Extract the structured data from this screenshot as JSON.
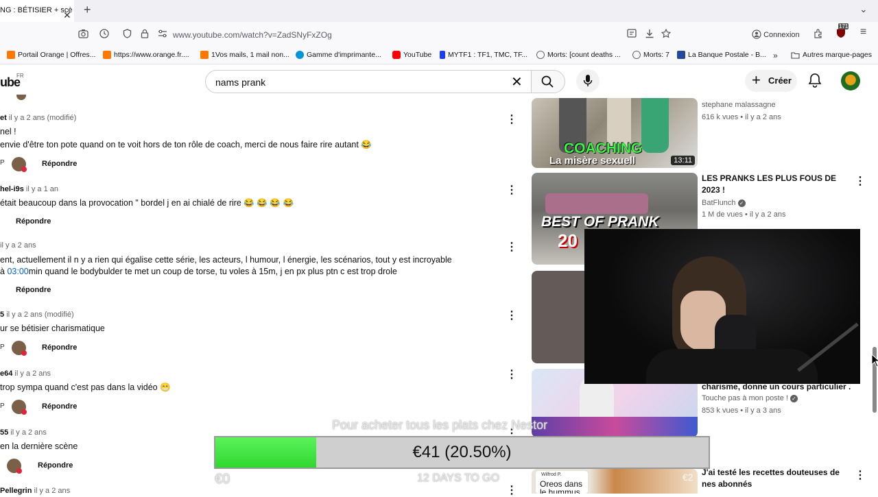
{
  "browser": {
    "tab_title": "NG : BÉTISIER + scè",
    "url": "www.youtube.com/watch?v=ZadSNyFxZOg",
    "login_label": "Connexion",
    "extension_badge": "171",
    "bookmarks": [
      {
        "label": "Portail Orange | Offres...",
        "color": "#ff7900"
      },
      {
        "label": "https://www.orange.fr....",
        "color": "#ff7900"
      },
      {
        "label": "1Vos mails, 1 mail non...",
        "color": "#ff7900"
      },
      {
        "label": "Gamme d'imprimante...",
        "color": "#0096d6"
      },
      {
        "label": "YouTube",
        "color": "#ff0000"
      },
      {
        "label": "MYTF1 : TF1, TMC, TF...",
        "color": "#1a3cff"
      },
      {
        "label": "Morts: [count deaths ...",
        "color": "#666666"
      },
      {
        "label": "Morts: 7",
        "color": "#666666"
      },
      {
        "label": "La Banque Postale - B...",
        "color": "#254a9b"
      }
    ],
    "bookmarks_other": "Autres marque-pages"
  },
  "youtube": {
    "logo": "ube",
    "country": "FR",
    "search_value": "nams prank",
    "create_label": "Créer"
  },
  "comments": [
    {
      "name": "et",
      "time": "il y a 2 ans (modifié)",
      "lines": [
        "nel !",
        "envie d'être ton pote quand on te voit hors de ton rôle de coach, merci de nous faire rire autant 😂"
      ],
      "reply": "Répondre"
    },
    {
      "name": "hel-i9s",
      "time": "il y a 1 an",
      "lines": [
        "était beaucoup dans la provocation \" bordel j en ai chialé de rire 😂 😂 😂 😂"
      ],
      "reply": "Répondre"
    },
    {
      "name": "",
      "time": "il y a 2 ans",
      "lines": [
        "ent, actuellement il n y a rien qui égalise cette série, les acteurs, l humour, l énergie, les scénarios, tout y est incroyable"
      ],
      "line2_prefix": " à ",
      "line2_timestamp": "03:00",
      "line2_suffix": "min quand le bodybulder te met un coup de torse, tu voles à 15m, j en px plus ptn c est trop drole",
      "reply": "Répondre"
    },
    {
      "name": "5",
      "time": "il y a 2 ans (modifié)",
      "lines": [
        "ur se bétisier charismatique"
      ],
      "reply": "Répondre"
    },
    {
      "name": "e64",
      "time": "il y a 2 ans",
      "lines": [
        "trop sympa quand c'est pas dans la vidéo 😁"
      ],
      "reply": "Répondre"
    },
    {
      "name": "55",
      "time": "il y a 2 ans",
      "lines": [
        "en la dernière scène"
      ],
      "reply": "Répondre"
    },
    {
      "name": "Pellegrin",
      "time": "il y a 2 ans"
    }
  ],
  "sidebar": [
    {
      "channel": "stephane malassagne",
      "meta": "616 k vues • il y a 2 ans",
      "thumb_text_1": "COACHING",
      "thumb_text_2": "La misère sexuell",
      "duration": "13:11"
    },
    {
      "title": "LES PRANKS LES PLUS FOUS DE 2023 !",
      "channel": "BatFlunch",
      "meta": "1 M de vues • il y a 2 ans",
      "thumb_text": "BEST OF PRANK",
      "thumb_text_2": "20"
    },
    {},
    {
      "title": "charisme, donne un cours particulier ...",
      "channel": "Touche pas à mon poste !",
      "meta": "853 k vues • il y a 3 ans"
    },
    {
      "title": "J'ai testé les recettes douteuses de nes abonnés",
      "thumb_badge_1": "Wilfrod P.",
      "thumb_badge_2": "Oreos dans",
      "thumb_badge_3": "le hummus",
      "thumb_price": "€2"
    }
  ],
  "overlay": {
    "ticker": "Pour acheter tous les plats chez Nestor",
    "progress_label": "€41 (20.50%)",
    "progress_fraction": 0.205,
    "start_label": "€0",
    "days_label": "12 DAYS TO GO"
  }
}
